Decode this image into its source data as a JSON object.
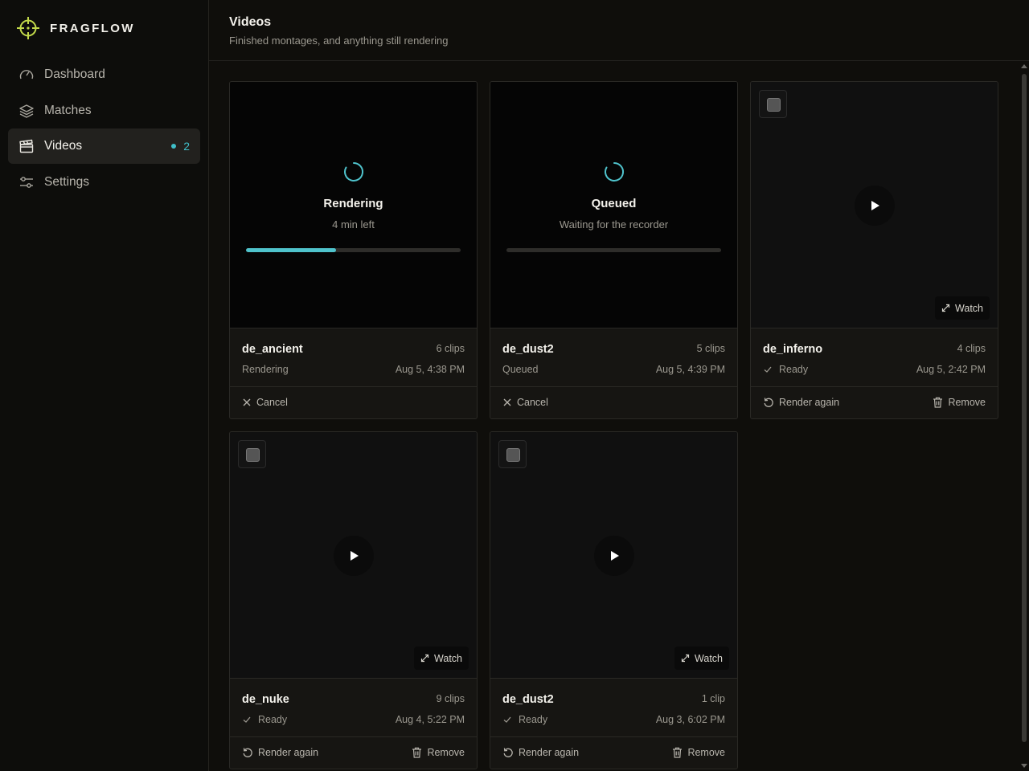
{
  "app": {
    "name": "FRAGFLOW",
    "accent": "#3fbfc9",
    "brand_color": "#c2d94a"
  },
  "nav": {
    "items": [
      {
        "label": "Dashboard",
        "icon": "gauge-icon",
        "active": false
      },
      {
        "label": "Matches",
        "icon": "layers-icon",
        "active": false
      },
      {
        "label": "Videos",
        "icon": "clapperboard-icon",
        "active": true,
        "badge": "2"
      },
      {
        "label": "Settings",
        "icon": "sliders-icon",
        "active": false
      }
    ]
  },
  "header": {
    "title": "Videos",
    "subtitle": "Finished montages, and anything still rendering"
  },
  "cards": [
    {
      "map": "de_ancient",
      "clips": "6 clips",
      "status": "Rendering",
      "date": "Aug 5, 4:38 PM",
      "state_title": "Rendering",
      "state_sub": "4 min left",
      "progress": 0.42,
      "action_left": "Cancel"
    },
    {
      "map": "de_dust2",
      "clips": "5 clips",
      "status": "Queued",
      "date": "Aug 5, 4:39 PM",
      "state_title": "Queued",
      "state_sub": "Waiting for the recorder",
      "progress": 0,
      "action_left": "Cancel"
    },
    {
      "map": "de_inferno",
      "clips": "4 clips",
      "status": "Ready",
      "date": "Aug 5, 2:42 PM",
      "watch": "Watch",
      "action_left": "Render again",
      "action_right": "Remove"
    },
    {
      "map": "de_nuke",
      "clips": "9 clips",
      "status": "Ready",
      "date": "Aug 4, 5:22 PM",
      "watch": "Watch",
      "action_left": "Render again",
      "action_right": "Remove"
    },
    {
      "map": "de_dust2",
      "clips": "1 clip",
      "status": "Ready",
      "date": "Aug 3, 6:02 PM",
      "watch": "Watch",
      "action_left": "Render again",
      "action_right": "Remove"
    }
  ]
}
